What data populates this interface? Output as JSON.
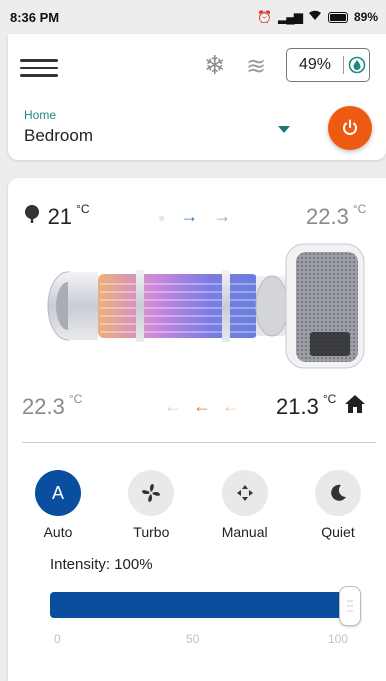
{
  "status_bar": {
    "time": "8:36 PM",
    "battery": "89%"
  },
  "header": {
    "humidity_value": "49%",
    "home_label": "Home",
    "room_label": "Bedroom"
  },
  "temps": {
    "outdoor_in": "21",
    "outdoor_out": "22.3",
    "indoor_out": "22.3",
    "indoor_in": "21.3",
    "unit": "°C"
  },
  "modes": [
    {
      "label": "Auto",
      "icon": "A",
      "active": true
    },
    {
      "label": "Turbo",
      "icon": "fan-icon",
      "active": false
    },
    {
      "label": "Manual",
      "icon": "manual-icon",
      "active": false
    },
    {
      "label": "Quiet",
      "icon": "moon-icon",
      "active": false
    }
  ],
  "intensity": {
    "label": "Intensity: 100%",
    "value": 100,
    "ticks": [
      "0",
      "50",
      "100"
    ]
  },
  "colors": {
    "accent_teal": "#1b8a84",
    "power_orange": "#ee5a12",
    "primary_blue": "#0a4ea0",
    "arrow_blue": "#2e7ad1",
    "arrow_orange": "#f07a2a"
  }
}
